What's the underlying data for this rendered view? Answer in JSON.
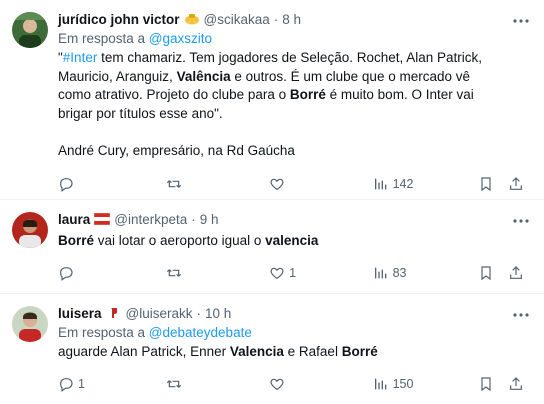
{
  "tweets": [
    {
      "name": "jurídico john victor",
      "handle": "@scikakaa",
      "separator": "·",
      "time": "8 h",
      "reply_prefix": "Em resposta a ",
      "reply_to": "@gaxszito",
      "text": {
        "hashtag": "#Inter",
        "t1": " tem chamariz. Tem jogadores de Seleção. Rochet, Alan Patrick, Mauricio, Aranguiz, ",
        "b1": "Valência",
        "t2": " e outros. É um clube que o mercado vê como atrativo. Projeto do clube para o ",
        "b2": "Borré",
        "t3": " é muito bom. O Inter vai brigar por títulos esse ano\".",
        "quote_open": "\"",
        "signature": "André Cury, empresário, na Rd Gaúcha"
      },
      "reply_count": "",
      "retweet_count": "",
      "like_count": "",
      "views": "142",
      "avatar_color": "#3e6b3a"
    },
    {
      "name": "laura",
      "handle": "@interkpeta",
      "separator": "·",
      "time": "9 h",
      "text": {
        "b1": "Borré",
        "t1": " vai lotar o aeroporto igual o ",
        "b2": "valencia"
      },
      "reply_count": "",
      "retweet_count": "",
      "like_count": "1",
      "views": "83",
      "avatar_color": "#b3261e"
    },
    {
      "name": "luisera",
      "handle": "@luiserakk",
      "separator": "·",
      "time": "10 h",
      "reply_prefix": "Em resposta a ",
      "reply_to": "@debateydebate",
      "text": {
        "t1": "aguarde Alan Patrick, Enner ",
        "b1": "Valencia",
        "t2": " e Rafael ",
        "b2": "Borré"
      },
      "reply_count": "1",
      "retweet_count": "",
      "like_count": "",
      "views": "150",
      "avatar_color": "#c9d6c2"
    }
  ],
  "colors": {
    "accent": "#1d9bf0",
    "muted": "#536471",
    "text": "#0f1419",
    "divider": "#eff3f4"
  },
  "icons": [
    "more-icon",
    "reply-icon",
    "retweet-icon",
    "like-icon",
    "views-icon",
    "bookmark-icon",
    "share-icon"
  ]
}
